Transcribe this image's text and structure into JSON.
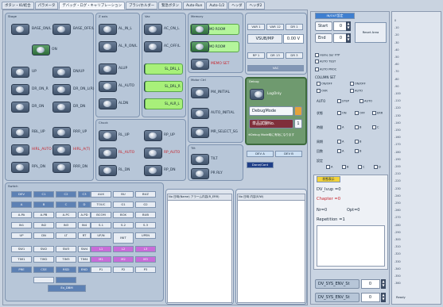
{
  "tabs": [
    "ボタン・IO/結合",
    "パラメータ",
    "デバッグ・ログ・キャリブレーション",
    "ブラシ/ホルダー",
    "緊急ボタン",
    "Auto-Run",
    "Auto-1/2",
    "ヘッダ",
    "ヘッダ2"
  ],
  "panes": {
    "p1": "Stage",
    "p2": "Z axis",
    "p3": "Vac",
    "p4": "Memory",
    "p5": "Chuck",
    "p6": "Motor Ctrl",
    "p7": "Debug",
    "p8": "Tilt",
    "p9": "Switch",
    "p10": "Log",
    "p11": "Log"
  },
  "col1": [
    {
      "t": "BASE_ON/L",
      "r": 0
    },
    {
      "t": "BASE_OFF/L",
      "r": 0
    },
    {
      "t": "ON",
      "r": 0
    },
    {
      "t": "UP",
      "r": 0
    },
    {
      "t": "DN/UP",
      "r": 0
    },
    {
      "t": "DR_ON_R",
      "r": 0
    },
    {
      "t": "DR_ON_L(R)",
      "r": 0
    },
    {
      "t": "DR_ON",
      "r": 0
    },
    {
      "t": "DR_DN",
      "r": 0
    },
    {
      "t": "RBL_UP",
      "r": 0
    },
    {
      "t": "RRR_UP",
      "r": 0
    },
    {
      "t": "HIRL_AUTO",
      "r": 1
    },
    {
      "t": "HIRL_A(T)",
      "r": 1
    },
    {
      "t": "RPL_DN",
      "r": 0
    },
    {
      "t": "RRR_DN",
      "r": 0
    }
  ],
  "col2": [
    {
      "t": "AL_IN_L",
      "r": 0
    },
    {
      "t": "AL_R_ON/L",
      "r": 0
    },
    {
      "t": "ALUP",
      "r": 0
    },
    {
      "t": "AL_AUTO",
      "r": 0
    },
    {
      "t": "ALDN",
      "r": 0
    },
    {
      "t": "RL_UP",
      "r": 0
    },
    {
      "t": "RL_AUTO",
      "r": 1
    },
    {
      "t": "RL_DN",
      "r": 0
    }
  ],
  "col3": [
    {
      "t": "AC_ON_L",
      "r": 0
    },
    {
      "t": "AC_OFF/L",
      "r": 0
    },
    {
      "t": "Z_UP",
      "r": 0
    },
    {
      "t": "Z_AUTO",
      "r": 0
    },
    {
      "t": "Z_DN",
      "r": 0
    },
    {
      "t": "RP_UP",
      "r": 0
    },
    {
      "t": "RP_AUTO",
      "r": 1
    },
    {
      "t": "RP_DN",
      "r": 0
    }
  ],
  "greens": [
    "SL_DRL_L",
    "SL_DRL_R",
    "SL_ALR_L"
  ],
  "mem": [
    "MEMO ROOM",
    "MEMO ROOM"
  ],
  "memo_set": "MEMO SET",
  "motor": [
    "M4_INITIAL",
    "AUTO_INITIAL",
    "MR_SELECT_SG"
  ],
  "vac": {
    "row1": [
      "VAR 1",
      "VAR 12",
      "DR 1"
    ],
    "label": "VSUB/MP",
    "val": "0.00 V",
    "row2": [
      "RP 1",
      "DR 13",
      "DR 3"
    ],
    "bar": "VAC"
  },
  "debug": {
    "log": "LogOnly",
    "mode": "DebugMode",
    "sel": "単品試験No.",
    "num": "1",
    "note": "※Debug Mode時に有効になります"
  },
  "tilt": {
    "a": "TILT",
    "b": "PR RLY"
  },
  "tiny": [
    "DEV A",
    "DEV B",
    "Done/Cont"
  ],
  "grid": [
    [
      "DEV",
      "C1",
      "C2",
      "C3",
      "AUX",
      "BU",
      "BUZ"
    ],
    [
      "A",
      "B",
      "C",
      "D",
      "TOUC",
      "G1",
      "G2"
    ],
    [
      "A-PA",
      "A-PB",
      "A-PC",
      "A-PD",
      "BCOM",
      "BOX",
      "BUB"
    ],
    [
      "IN1",
      "IN2",
      "IN3",
      "IN4",
      "S.1",
      "S.2",
      "S.3"
    ],
    [
      "UP",
      "DN",
      "LT",
      "RT",
      "UP/N",
      "INIT",
      "UPEN"
    ],
    [
      "SW1",
      "SW2",
      "SW3",
      "SW4",
      "L1",
      "L2",
      "L3"
    ],
    [
      "TIM1",
      "TIM2",
      "TIM3",
      "TIM4",
      "M1",
      "M2",
      "M3"
    ],
    [
      "PRE",
      "CSE",
      "RSD",
      "END",
      "P1",
      "P2",
      "P3"
    ]
  ],
  "gridfoot": "Ex_DBM",
  "lists": {
    "l1": "No  日時(Name)  アラーム内容(R_ERR)",
    "l2": "No  日時  内容(E/W)"
  },
  "right": {
    "title": "IN/OUT設定",
    "start_lbl": "Start",
    "start": "0",
    "end_lbl": "End",
    "end": "0",
    "btn": "Reset Area",
    "opts": [
      "Home Ser FTP",
      "AUTO TEST",
      "AUTO PROC"
    ],
    "grp": "COLUMN SET",
    "r1": [
      "ON/OFF",
      "ON/OFF"
    ],
    "r2": [
      "OVR",
      "AUTO"
    ],
    "rows": [
      {
        "l": "AUTO",
        "c": [
          "STEP",
          "AUTO"
        ]
      },
      {
        "l": "状態",
        "c": [
          "ON",
          "OFF",
          "ERR"
        ]
      },
      {
        "l": "時間",
        "c": [
          "A",
          "B",
          "C"
        ]
      },
      {
        "l": "周期",
        "c": [
          "A",
          "B"
        ]
      },
      {
        "l": "回数",
        "c": [
          "A",
          "B"
        ]
      },
      {
        "l": "設定",
        "c": [
          "A",
          "B",
          "C",
          "D"
        ]
      }
    ],
    "status_t": "状態表示",
    "dv": "DV_Ivup  =0",
    "chapter": "Chapter =0",
    "nr": "Nr=0",
    "opt": "Opt=0",
    "rep": "Repetition =1",
    "sys1": "DV_SYS_ENV_St",
    "v1": "0",
    "sys2": "DV_SYS_ENV_St",
    "v2": "0"
  },
  "scale": [
    "0",
    "-10",
    "-20",
    "-30",
    "-40",
    "-50",
    "-60",
    "-70",
    "-80",
    "-90",
    "-100",
    "-110",
    "-120",
    "-130",
    "-140",
    "-150",
    "-160",
    "-170",
    "-180",
    "-190",
    "-200",
    "-210",
    "-220",
    "-230",
    "-240",
    "-250",
    "-260",
    "-270",
    "-280",
    "-290",
    "-300",
    "-310",
    "-320",
    "-330",
    "-340",
    "-350",
    "-360"
  ],
  "scale_foot": "Ready"
}
